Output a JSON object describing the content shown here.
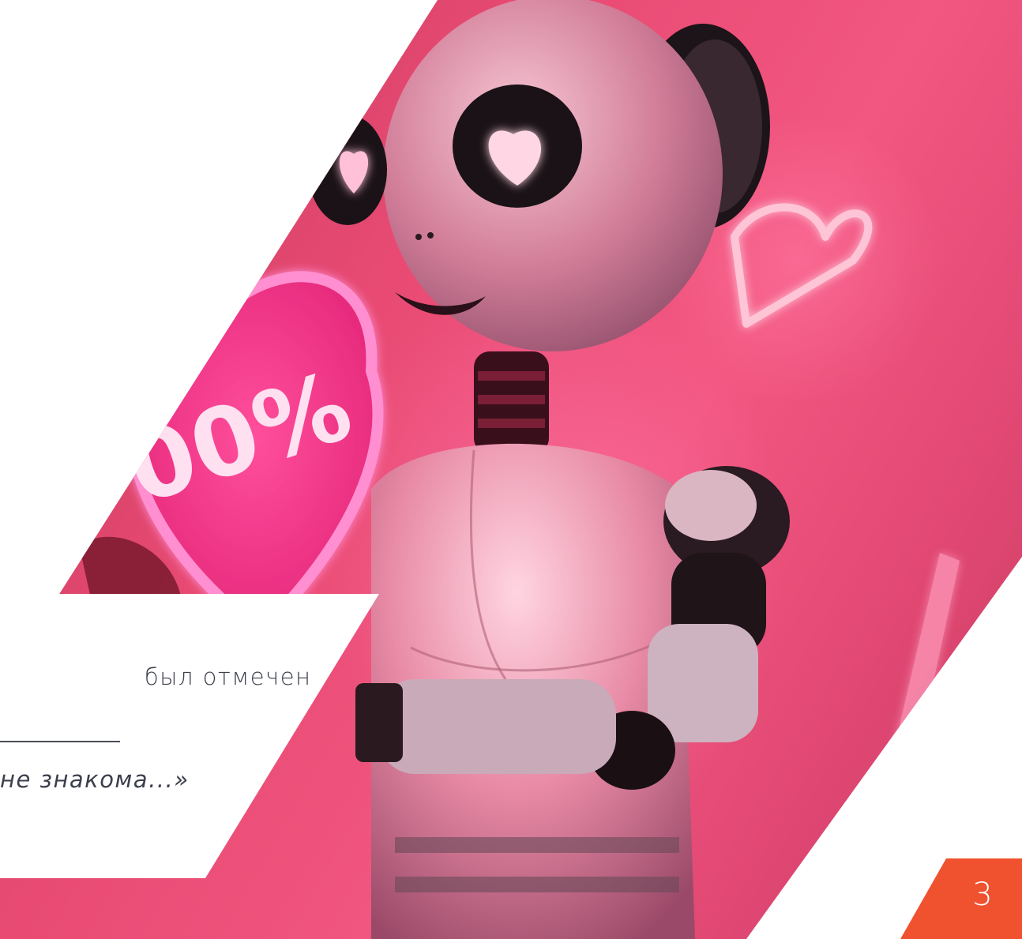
{
  "photo": {
    "heart_sign_text": "00%"
  },
  "card": {
    "line1": "был отмечен",
    "line2": "не знакома...»"
  },
  "footer": {
    "page_number": "3",
    "accent_color": "#f0522f"
  },
  "colors": {
    "photo_pink": "#e84a73",
    "neon_pink": "#ff3f9a",
    "text": "#3c3f4c"
  }
}
